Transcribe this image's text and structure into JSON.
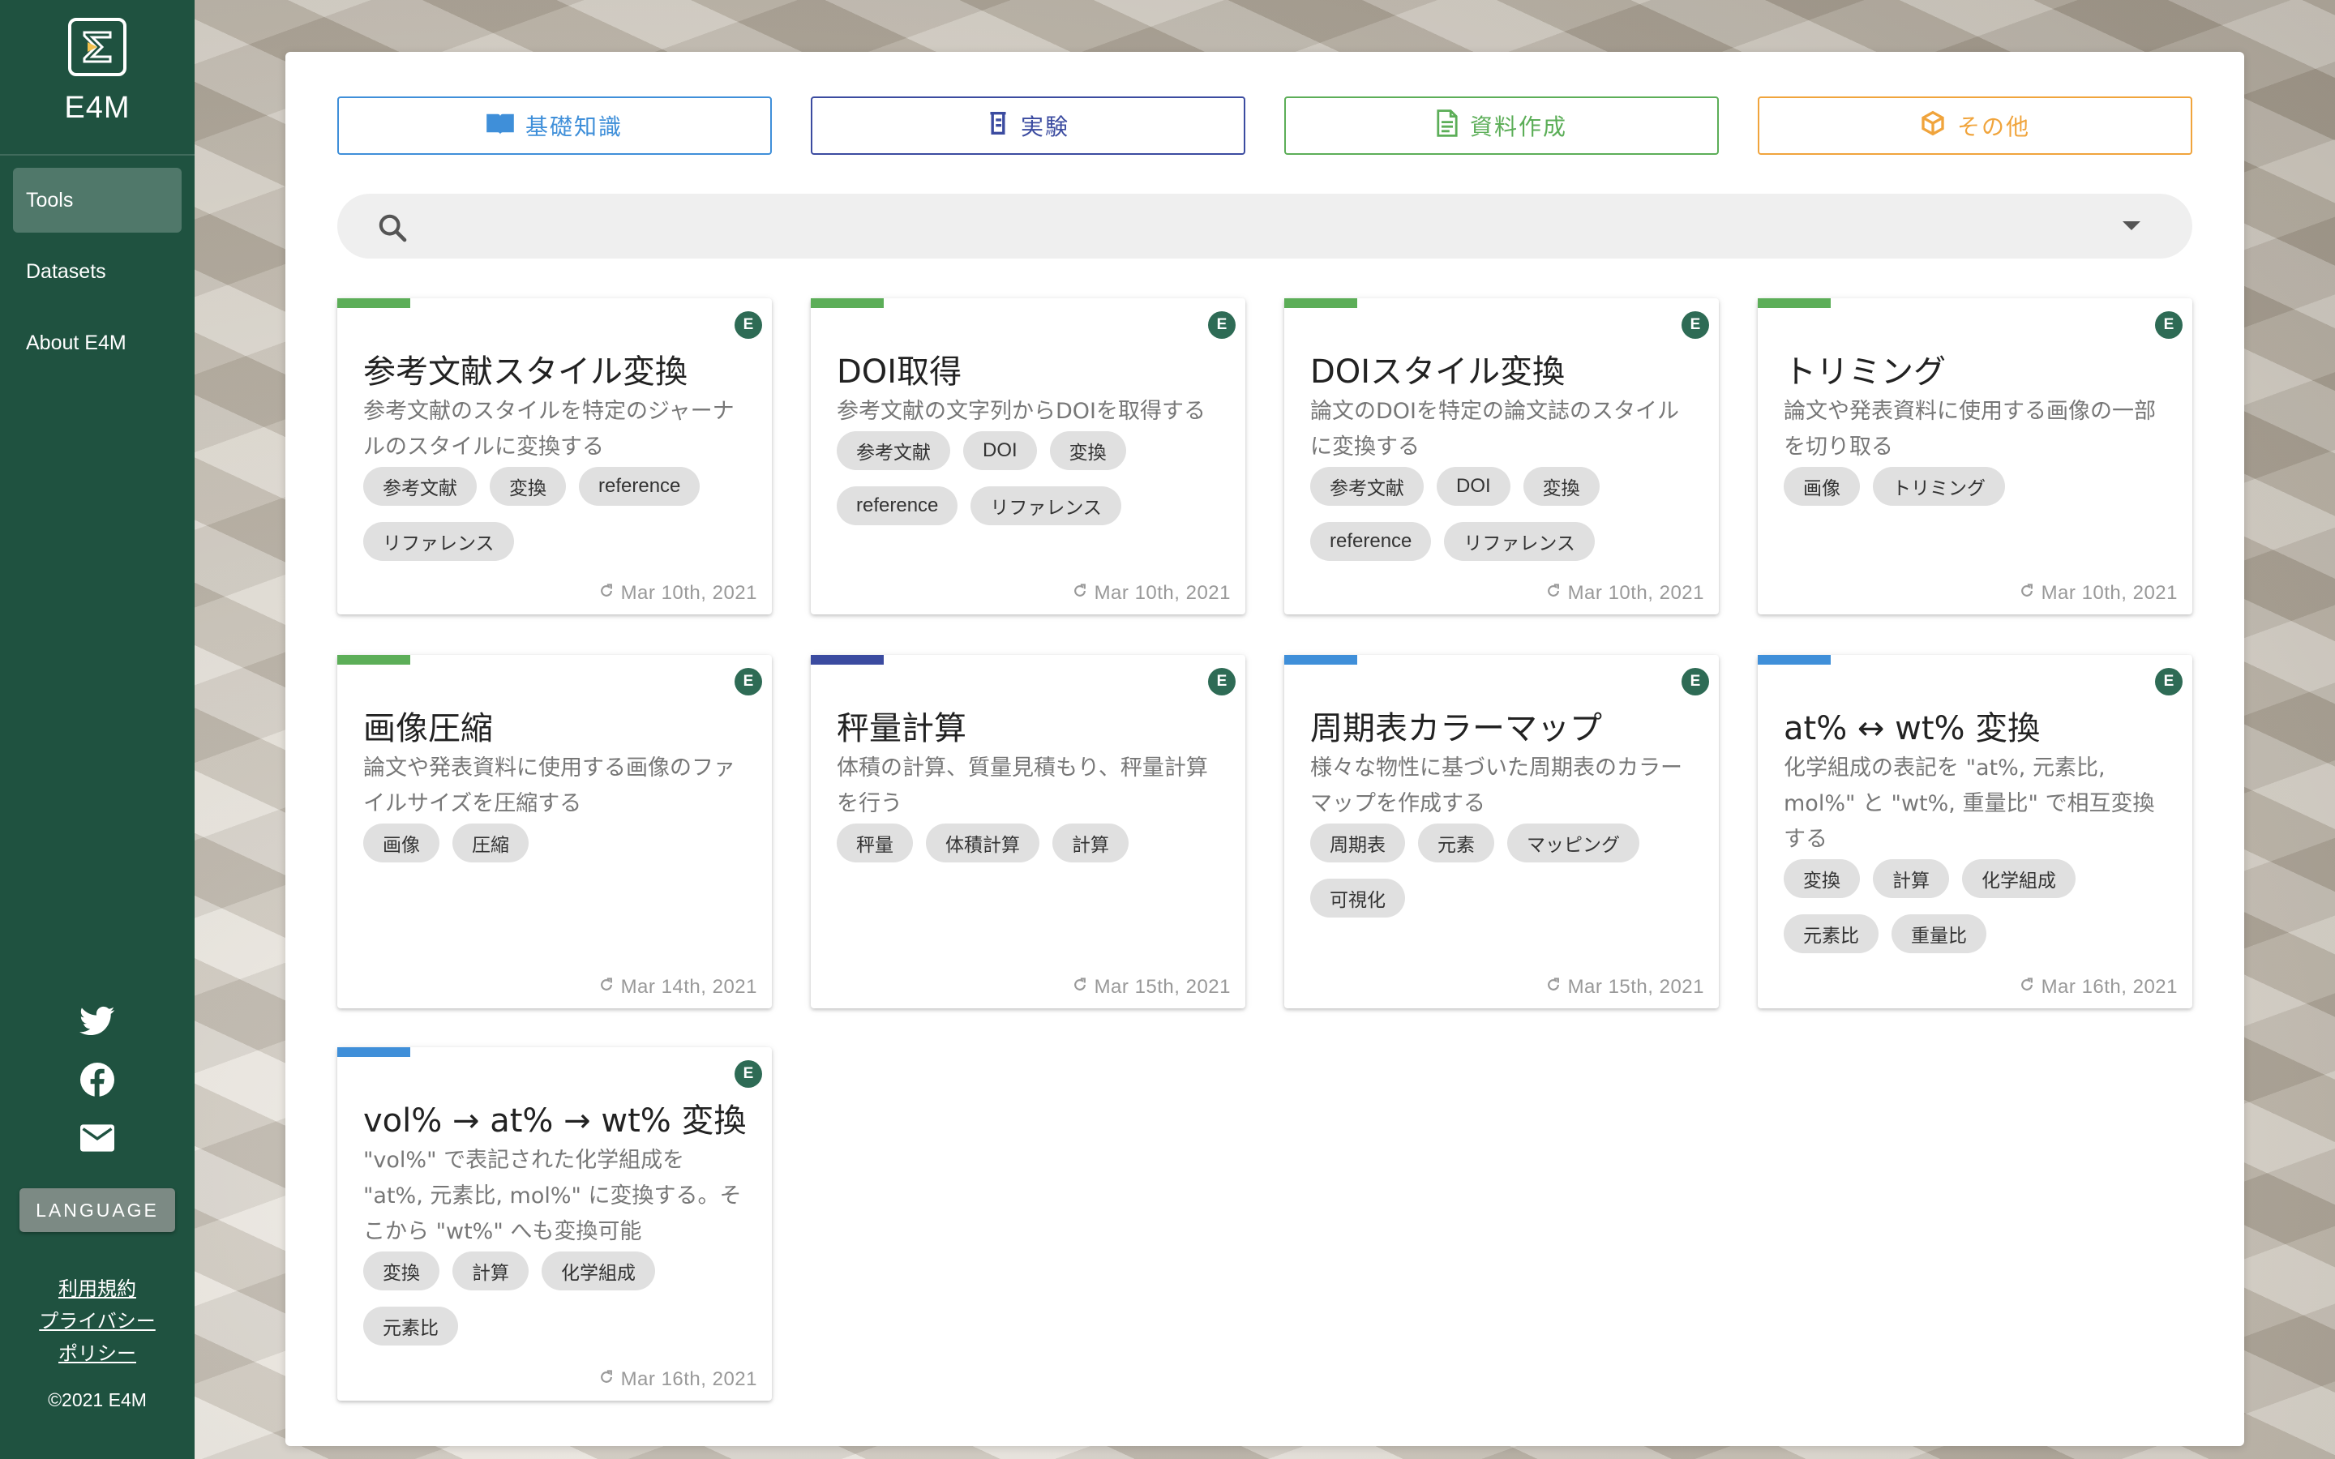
{
  "brand": {
    "name": "E4M"
  },
  "sidebar": {
    "items": [
      {
        "label": "Tools",
        "active": true
      },
      {
        "label": "Datasets",
        "active": false
      },
      {
        "label": "About E4M",
        "active": false
      }
    ],
    "social_icons": [
      "twitter-icon",
      "facebook-icon",
      "mail-icon"
    ],
    "language_button": "LANGUAGE",
    "terms_link": "利用規約",
    "privacy_link_line1": "プライバシー",
    "privacy_link_line2": "ポリシー",
    "copyright": "©2021 E4M"
  },
  "categories": [
    {
      "label": "基礎知識",
      "color": "#3f8fd9",
      "icon": "book-icon"
    },
    {
      "label": "実験",
      "color": "#3b4ba0",
      "icon": "beaker-icon"
    },
    {
      "label": "資料作成",
      "color": "#5cae58",
      "icon": "document-icon"
    },
    {
      "label": "その他",
      "color": "#f0a43c",
      "icon": "box-icon"
    }
  ],
  "search": {
    "placeholder": "",
    "value": ""
  },
  "cards": [
    {
      "title": "参考文献スタイル変換",
      "description": "参考文献のスタイルを特定のジャーナルのスタイルに変換する",
      "tags": [
        "参考文献",
        "変換",
        "reference",
        "リファレンス"
      ],
      "date": "Mar 10th, 2021",
      "accent": "#5cae58",
      "badge": "E"
    },
    {
      "title": "DOI取得",
      "description": "参考文献の文字列からDOIを取得する",
      "tags": [
        "参考文献",
        "DOI",
        "変換",
        "reference",
        "リファレンス"
      ],
      "date": "Mar 10th, 2021",
      "accent": "#5cae58",
      "badge": "E"
    },
    {
      "title": "DOIスタイル変換",
      "description": "論文のDOIを特定の論文誌のスタイルに変換する",
      "tags": [
        "参考文献",
        "DOI",
        "変換",
        "reference",
        "リファレンス"
      ],
      "date": "Mar 10th, 2021",
      "accent": "#5cae58",
      "badge": "E"
    },
    {
      "title": "トリミング",
      "description": "論文や発表資料に使用する画像の一部を切り取る",
      "tags": [
        "画像",
        "トリミング"
      ],
      "date": "Mar 10th, 2021",
      "accent": "#5cae58",
      "badge": "E"
    },
    {
      "title": "画像圧縮",
      "description": "論文や発表資料に使用する画像のファイルサイズを圧縮する",
      "tags": [
        "画像",
        "圧縮"
      ],
      "date": "Mar 14th, 2021",
      "accent": "#5cae58",
      "badge": "E"
    },
    {
      "title": "秤量計算",
      "description": "体積の計算、質量見積もり、秤量計算を行う",
      "tags": [
        "秤量",
        "体積計算",
        "計算"
      ],
      "date": "Mar 15th, 2021",
      "accent": "#3b4ba0",
      "badge": "E"
    },
    {
      "title": "周期表カラーマップ",
      "description": "様々な物性に基づいた周期表のカラーマップを作成する",
      "tags": [
        "周期表",
        "元素",
        "マッピング",
        "可視化"
      ],
      "date": "Mar 15th, 2021",
      "accent": "#3f8fd9",
      "badge": "E"
    },
    {
      "title": "at% ↔ wt% 変換",
      "description": "化学組成の表記を \"at%, 元素比, mol%\" と \"wt%, 重量比\" で相互変換する",
      "tags": [
        "変換",
        "計算",
        "化学組成",
        "元素比",
        "重量比"
      ],
      "date": "Mar 16th, 2021",
      "accent": "#3f8fd9",
      "badge": "E"
    },
    {
      "title": "vol% → at% → wt% 変換",
      "description": "\"vol%\" で表記された化学組成を \"at%, 元素比, mol%\" に変換する。そこから \"wt%\" へも変換可能",
      "tags": [
        "変換",
        "計算",
        "化学組成",
        "元素比"
      ],
      "date": "Mar 16th, 2021",
      "accent": "#3f8fd9",
      "badge": "E"
    }
  ]
}
